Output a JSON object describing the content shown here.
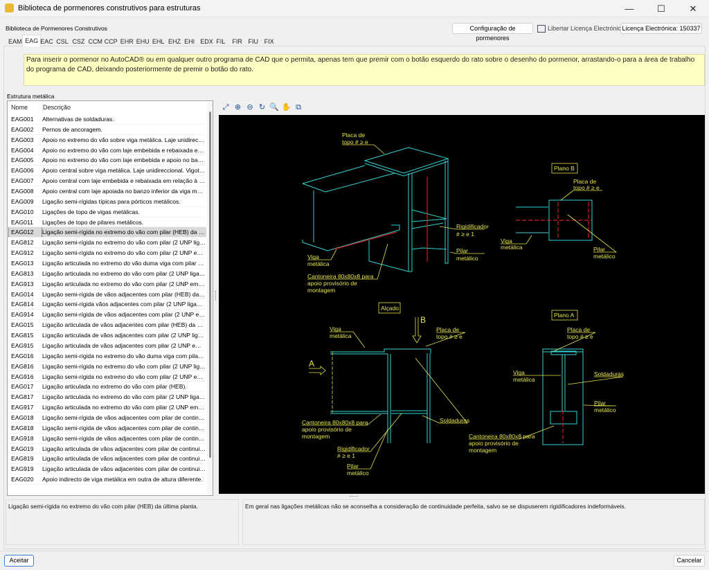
{
  "window": {
    "title": "Biblioteca de pormenores construtivos para estruturas",
    "minimize": "—",
    "maximize": "☐",
    "close": "✕",
    "app_icon": "library-icon"
  },
  "header": {
    "label": "Biblioteca de Pormenores Construtivos",
    "config_button": "Configuração de pormenores",
    "release_license": "Libertar Licença Electrónica",
    "license_button": "Licença Electrónica: 150337"
  },
  "tabs": [
    "EAM",
    "EAG",
    "EAC",
    "CSL",
    "CSZ",
    "CCM",
    "CCP",
    "EHR",
    "EHU",
    "EHL",
    "EHZ",
    "EHI",
    "EDX",
    "FIL",
    "FIR",
    "FIU",
    "FIX"
  ],
  "selected_tab": "EAG",
  "info": "Para inserir o pormenor no AutoCAD® ou em qualquer outro programa de CAD que o permita, apenas tem que premir com o botão esquerdo do rato sobre o desenho do pormenor, arrastando-o para a área de trabalho do programa de CAD, deixando posteriormente de premir o botão do rato.",
  "group_label": "Estrutura metálica",
  "list": {
    "columns": [
      "Nome",
      "Descrição"
    ],
    "selected": "EAG012",
    "rows": [
      [
        "EAG001",
        "Alternativas de soldaduras."
      ],
      [
        "EAG002",
        "Pernos de ancoragem."
      ],
      [
        "EAG003",
        "Apoio no extremo do vão sobre viga metálica. Laje unidireccional..."
      ],
      [
        "EAG004",
        "Apoio no extremo do vão com laje embebida e rebaixada em r..."
      ],
      [
        "EAG005",
        "Apoio no extremo do vão com laje embebida e apoio no banz..."
      ],
      [
        "EAG006",
        "Apoio central sobre viga metálica. Laje unidireccional. Vigota..."
      ],
      [
        "EAG007",
        "Apoio central com laje embebida e rebaixada em relação à vi..."
      ],
      [
        "EAG008",
        "Apoio central com laje apoiada no banzo inferior da viga metá..."
      ],
      [
        "EAG009",
        "Ligação semi-rígidas típicas para pórticos metálicos."
      ],
      [
        "EAG010",
        "Ligações de topo de vigas metálicas."
      ],
      [
        "EAG011",
        "Ligações de topo de pilares metálicos."
      ],
      [
        "EAG012",
        "Ligação semi-rígida no extremo do vão com pilar (HEB) da últi..."
      ],
      [
        "EAG812",
        "Ligação semi-rígida no extremo do vão com pilar (2 UNP liga..."
      ],
      [
        "EAG912",
        "Ligação semi-rígida no extremo do vão com pilar (2 UNP emp..."
      ],
      [
        "EAG013",
        "Ligação articulada no extremo do vão duma viga com pilar (H..."
      ],
      [
        "EAG813",
        "Ligação articulada no extremo do vão com pilar (2 UNP ligad..."
      ],
      [
        "EAG913",
        "Ligação articulada no extremo do vão com pilar (2 UNP empa..."
      ],
      [
        "EAG014",
        "Ligação semi-rígida de vãos adjacentes com pilar (HEB) da úl..."
      ],
      [
        "EAG814",
        "Ligação semi-rígida vãos adjacentes com pilar (2 UNP ligado..."
      ],
      [
        "EAG914",
        "Ligação semi-rígida de vãos adjacentes com pilar (2 UNP em..."
      ],
      [
        "EAG015",
        "Ligação articulada de vãos adjacentes com pilar (HEB) da últi..."
      ],
      [
        "EAG815",
        "Ligação articulada de vãos adjacentes com pilar (2 UNP liga..."
      ],
      [
        "EAG915",
        "Ligação articulada de vãos adjacentes com pilar (2 UNP emp..."
      ],
      [
        "EAG016",
        "Ligação semi-rígida no extremo do vão duma viga com pilar (..."
      ],
      [
        "EAG816",
        "Ligação semi-rígida no extremo do vão com pilar (2 UNP liga..."
      ],
      [
        "EAG916",
        "Ligação semi-rígida no extremo do vão com pilar (2 UNP emp..."
      ],
      [
        "EAG017",
        "Ligação articulada no extremo do vão com pilar (HEB)."
      ],
      [
        "EAG817",
        "Ligação articulada no extremo do vão com pilar (2 UNP ligad..."
      ],
      [
        "EAG917",
        "Ligação articulada no extremo do vão com pilar (2 UNP empa..."
      ],
      [
        "EAG018",
        "Ligação semi-rígida de vãos adjacentes com pilar de continui..."
      ],
      [
        "EAG818",
        "Ligação semi-rígida de vãos adjacentes com pilar de continui..."
      ],
      [
        "EAG918",
        "Ligação semi-rígida de vãos adjacentes com pilar de continui..."
      ],
      [
        "EAG019",
        "Ligação articulada de vãos adjacentes com pilar de continuid..."
      ],
      [
        "EAG819",
        "Ligação articulada de vãos adjacentes com pilar de continuid..."
      ],
      [
        "EAG919",
        "Ligação articulada de vãos adjacentes com pilar de continuid..."
      ],
      [
        "EAG020",
        "Apoio indirecto de viga metálica em outra de altura diferente."
      ]
    ]
  },
  "toolbar": [
    "zoom-extents-icon",
    "zoom-all-icon",
    "zoom-window-icon",
    "zoom-previous-icon",
    "zoom-icon",
    "pan-hand-icon",
    "copy-to-clipboard-icon"
  ],
  "drawing": {
    "colors": {
      "background": "#000000",
      "lines": "#33d6d6",
      "text": "#e6e64c",
      "hidden": "#cc2222"
    },
    "labels": {
      "iso_placa1": "Placa de",
      "iso_placa2": "topo # ≥  e",
      "iso_viga1": "Viga",
      "iso_viga2": "metálica",
      "iso_cant1": "Cantoneira  80x80x8  para",
      "iso_cant2": "apoio  provisório  de",
      "iso_cant3": "montagem",
      "iso_rig1": "Rigidificador",
      "iso_rig2": "# ≥  e 1",
      "iso_pilar1": "Pilar",
      "iso_pilar2": "metálico",
      "planoB": "Plano  B",
      "pb_placa1": "Placa  de",
      "pb_placa2": "topo  # ≥  e",
      "pb_viga1": "Viga",
      "pb_viga2": "metálica",
      "pb_pilar1": "Pilar",
      "pb_pilar2": "metálico",
      "alcado": "Alçado",
      "arrowB": "B",
      "arrowA": "A",
      "al_viga1": "Viga",
      "al_viga2": "metálica",
      "al_placa1": "Placa  de",
      "al_placa2": "topo  # ≥  e",
      "al_sold": "Soldaduras",
      "al_cant1": "Cantoneira  80x80x8  para",
      "al_cant2": "apoio  provisório  de",
      "al_cant3": "montagem",
      "al_rig1": "Rigidificador",
      "al_rig2": "# ≥  e 1",
      "al_pilar1": "Pilar",
      "al_pilar2": "metálico",
      "planoA": "Plano  A",
      "pa_placa1": "Placa  de",
      "pa_placa2": "topo  # ≥  e",
      "pa_viga1": "Viga",
      "pa_viga2": "metálica",
      "pa_sold": "Soldaduras",
      "pa_pilar1": "Pilar",
      "pa_pilar2": "metálico",
      "pa_cant1": "Cantoneira  80x80x8  para",
      "pa_cant2": "apoio  provisório  de",
      "pa_cant3": "montagem"
    }
  },
  "description": "Ligação semi-rígida no extremo do vão com pilar (HEB) da última planta.",
  "notes": "Em geral nas ligações metálicas não se aconselha a consideração de continuidade perfeita, salvo se se dispuserem rigidificadores indeformáveis.",
  "footer": {
    "accept": "Aceitar",
    "cancel": "Cancelar"
  }
}
